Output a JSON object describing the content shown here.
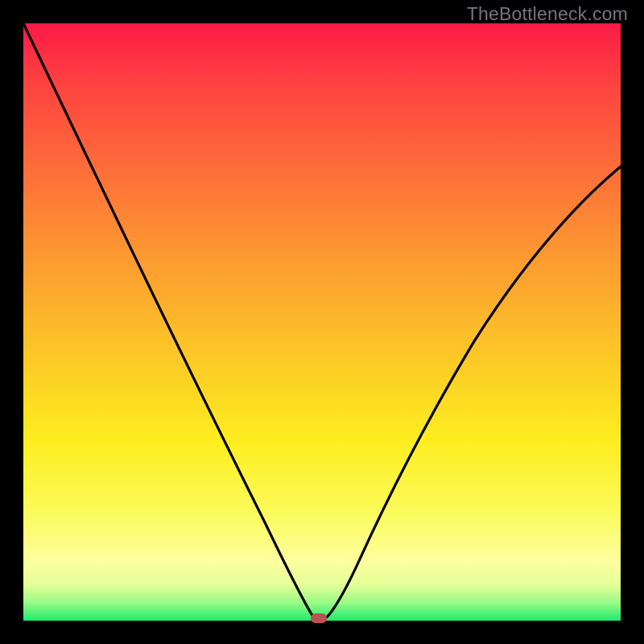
{
  "watermark": {
    "text": "TheBottleneck.com"
  },
  "chart_data": {
    "type": "line",
    "title": "",
    "xlabel": "",
    "ylabel": "",
    "xlim": [
      0,
      1
    ],
    "ylim": [
      0,
      1
    ],
    "series": [
      {
        "name": "bottleneck-curve",
        "x": [
          0.0,
          0.05,
          0.1,
          0.15,
          0.2,
          0.25,
          0.3,
          0.35,
          0.4,
          0.44,
          0.46,
          0.475,
          0.49,
          0.51,
          0.54,
          0.58,
          0.63,
          0.7,
          0.78,
          0.86,
          0.93,
          1.0
        ],
        "y": [
          1.0,
          0.895,
          0.79,
          0.685,
          0.58,
          0.475,
          0.37,
          0.265,
          0.16,
          0.07,
          0.03,
          0.008,
          0.0,
          0.015,
          0.06,
          0.14,
          0.24,
          0.37,
          0.5,
          0.61,
          0.69,
          0.76
        ]
      }
    ],
    "marker": {
      "x": 0.49,
      "y": 0.0,
      "color": "#bd5151"
    },
    "background": {
      "type": "vertical-gradient",
      "stops": [
        {
          "pos": 0.0,
          "color": "#fc1a46"
        },
        {
          "pos": 0.25,
          "color": "#fd6f39"
        },
        {
          "pos": 0.55,
          "color": "#fcc627"
        },
        {
          "pos": 0.82,
          "color": "#fbfb5c"
        },
        {
          "pos": 1.0,
          "color": "#1dec6c"
        }
      ]
    }
  },
  "colors": {
    "frame": "#000000",
    "curve": "#000000",
    "marker": "#bd5151",
    "watermark": "#73757a"
  }
}
